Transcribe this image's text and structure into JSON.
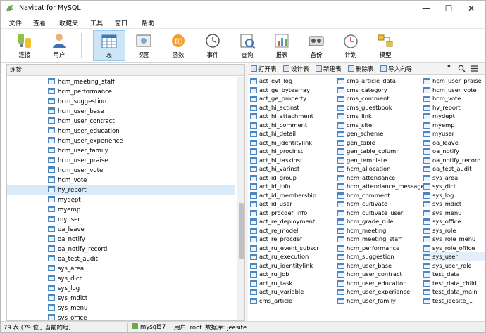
{
  "window": {
    "title": "Navicat for MySQL",
    "minimize": "—",
    "maximize": "☐",
    "close": "✕"
  },
  "menu": [
    "文件",
    "查看",
    "收藏夹",
    "工具",
    "窗口",
    "帮助"
  ],
  "toolbar": [
    {
      "label": "连接",
      "icon": "connect-icon"
    },
    {
      "label": "用户",
      "icon": "user-icon"
    },
    {
      "label": "表",
      "icon": "table-icon",
      "active": true
    },
    {
      "label": "视图",
      "icon": "view-icon"
    },
    {
      "label": "函数",
      "icon": "function-icon"
    },
    {
      "label": "事件",
      "icon": "event-icon"
    },
    {
      "label": "查询",
      "icon": "query-icon"
    },
    {
      "label": "报表",
      "icon": "report-icon"
    },
    {
      "label": "备份",
      "icon": "backup-icon"
    },
    {
      "label": "计划",
      "icon": "schedule-icon"
    },
    {
      "label": "模型",
      "icon": "model-icon"
    }
  ],
  "left_pane": {
    "header": "连接",
    "items": [
      "hcm_meeting_staff",
      "hcm_performance",
      "hcm_suggestion",
      "hcm_user_base",
      "hcm_user_contract",
      "hcm_user_education",
      "hcm_user_experience",
      "hcm_user_family",
      "hcm_user_praise",
      "hcm_user_vote",
      "hcm_vote",
      "hy_report",
      "mydept",
      "myemp",
      "myuser",
      "oa_leave",
      "oa_notify",
      "oa_notify_record",
      "oa_test_audit",
      "sys_area",
      "sys_dict",
      "sys_log",
      "sys_mdict",
      "sys_menu",
      "sys_office"
    ],
    "selected": "hy_report"
  },
  "object_toolbar": {
    "open": "打开表",
    "design": "设计表",
    "new": "新建表",
    "delete": "删除表",
    "import": "导入向导",
    "more": "»"
  },
  "objects": {
    "col1": [
      "act_evt_log",
      "act_ge_bytearray",
      "act_ge_property",
      "act_hi_actinst",
      "act_hi_attachment",
      "act_hi_comment",
      "act_hi_detail",
      "act_hi_identitylink",
      "act_hi_procinst",
      "act_hi_taskinst",
      "act_hi_varinst",
      "act_id_group",
      "act_id_info",
      "act_id_membership",
      "act_id_user",
      "act_procdef_info",
      "act_re_deployment",
      "act_re_model",
      "act_re_procdef",
      "act_ru_event_subscr",
      "act_ru_execution",
      "act_ru_identitylink",
      "act_ru_job",
      "act_ru_task",
      "act_ru_variable",
      "cms_article"
    ],
    "col2": [
      "cms_article_data",
      "cms_category",
      "cms_comment",
      "cms_guestbook",
      "cms_link",
      "cms_site",
      "gen_scheme",
      "gen_table",
      "gen_table_column",
      "gen_template",
      "hcm_allocation",
      "hcm_attendance",
      "hcm_attendance_message",
      "hcm_comment",
      "hcm_cultivate",
      "hcm_cultivate_user",
      "hcm_grade_rule",
      "hcm_meeting",
      "hcm_meeting_staff",
      "hcm_performance",
      "hcm_suggestion",
      "hcm_user_base",
      "hcm_user_contract",
      "hcm_user_education",
      "hcm_user_experience",
      "hcm_user_family"
    ],
    "col3": [
      "hcm_user_praise",
      "hcm_user_vote",
      "hcm_vote",
      "hy_report",
      "mydept",
      "myemp",
      "myuser",
      "oa_leave",
      "oa_notify",
      "oa_notify_record",
      "oa_test_audit",
      "sys_area",
      "sys_dict",
      "sys_log",
      "sys_mdict",
      "sys_menu",
      "sys_office",
      "sys_role",
      "sys_role_menu",
      "sys_role_office",
      "sys_user",
      "sys_user_role",
      "test_data",
      "test_data_child",
      "test_data_main",
      "test_jeesite_1"
    ],
    "highlighted": "sys_user"
  },
  "status": {
    "count": "79 表 (79 位于当前的组)",
    "connection": "mysql57",
    "user": "用户: root",
    "database": "数据库: jeesite"
  }
}
